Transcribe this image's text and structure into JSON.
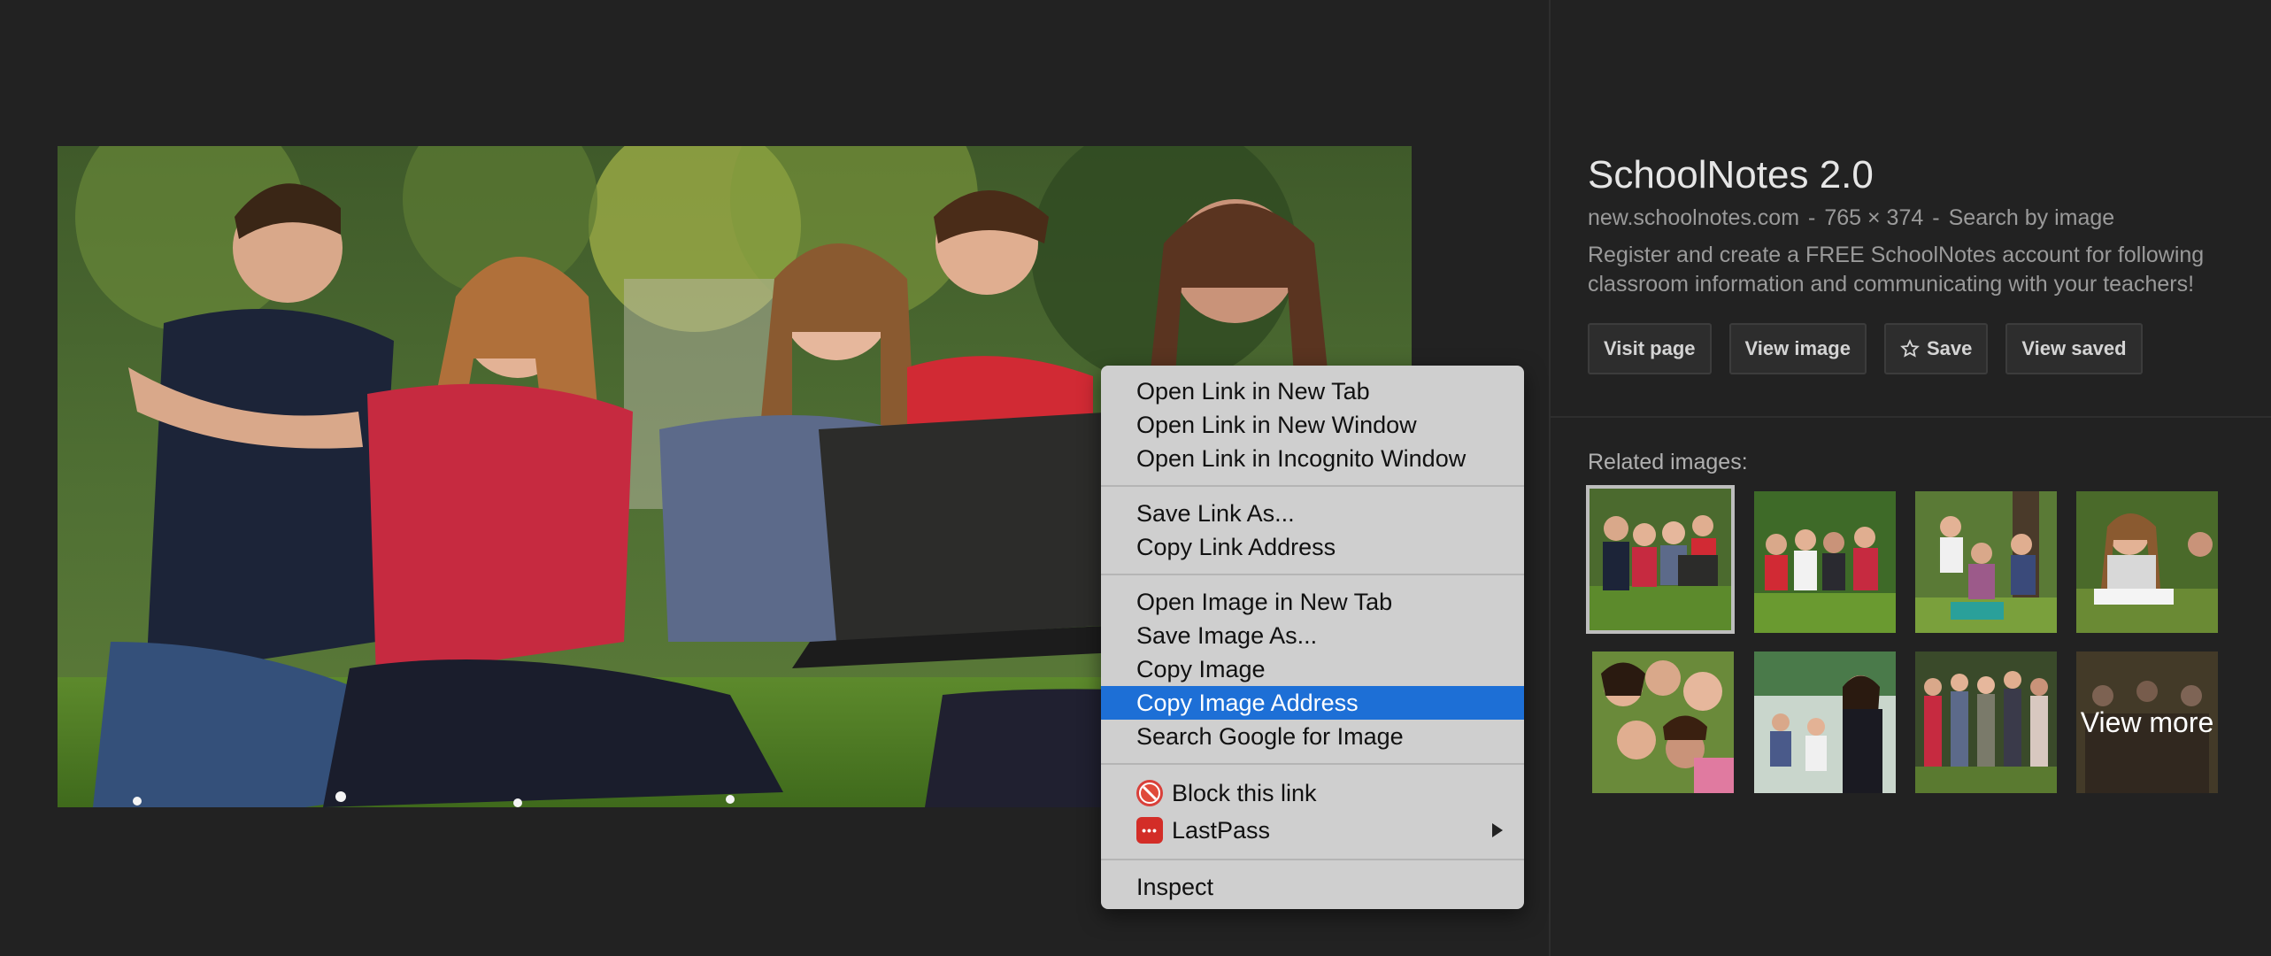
{
  "result": {
    "title": "SchoolNotes 2.0",
    "domain": "new.schoolnotes.com",
    "sep1": "-",
    "dimensions": "765 × 374",
    "sep2": "-",
    "search_by_image": "Search by image",
    "description": "Register and create a FREE SchoolNotes account for following classroom information and communicating with your teachers!"
  },
  "buttons": {
    "visit_page": "Visit page",
    "view_image": "View image",
    "save": "Save",
    "save_icon": "star-icon",
    "view_saved": "View saved"
  },
  "related": {
    "label": "Related images:",
    "view_more": "View more"
  },
  "context_menu": {
    "open_link_new_tab": "Open Link in New Tab",
    "open_link_new_window": "Open Link in New Window",
    "open_link_incognito": "Open Link in Incognito Window",
    "save_link_as": "Save Link As...",
    "copy_link_address": "Copy Link Address",
    "open_image_new_tab": "Open Image in New Tab",
    "save_image_as": "Save Image As...",
    "copy_image": "Copy Image",
    "copy_image_address": "Copy Image Address",
    "search_google_image": "Search Google for Image",
    "block_this_link": "Block this link",
    "lastpass": "LastPass",
    "lastpass_icon_text": "•••",
    "inspect": "Inspect",
    "highlighted_item": "Copy Image Address"
  },
  "colors": {
    "background": "#222222",
    "menu_highlight": "#1d6fd6",
    "menu_background": "#cfcfcf"
  }
}
